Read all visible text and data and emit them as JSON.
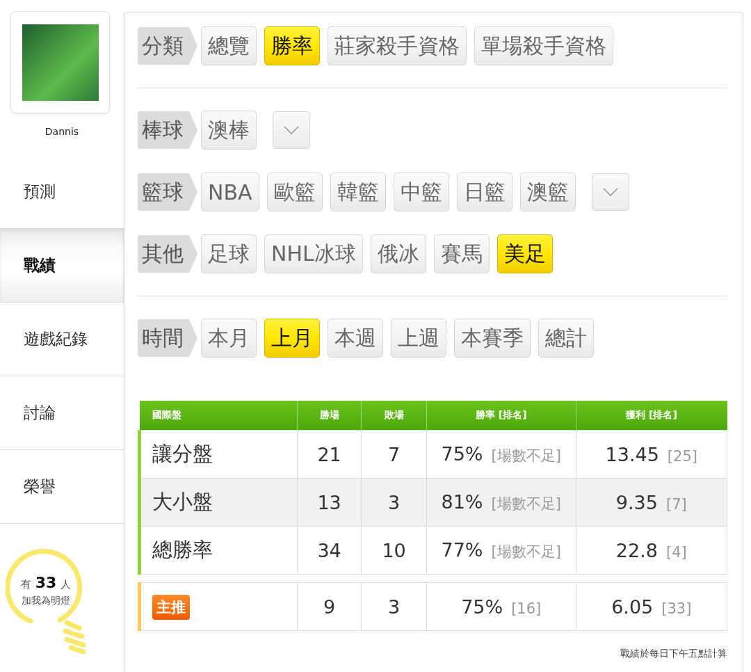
{
  "sidebar": {
    "username": "Dannis",
    "items": [
      {
        "label": "預測",
        "selected": false
      },
      {
        "label": "戰績",
        "selected": true
      },
      {
        "label": "遊戲紀錄",
        "selected": false
      },
      {
        "label": "討論",
        "selected": false
      },
      {
        "label": "榮譽",
        "selected": false
      }
    ],
    "fans": {
      "prefix": "有",
      "count": "33",
      "suffix": "人",
      "caption": "加我為明燈"
    }
  },
  "filter_sections": [
    [
      {
        "label": "分類",
        "dropdown": false,
        "options": [
          {
            "label": "總覽",
            "selected": false
          },
          {
            "label": "勝率",
            "selected": true
          },
          {
            "label": "莊家殺手資格",
            "selected": false
          },
          {
            "label": "單場殺手資格",
            "selected": false
          }
        ]
      }
    ],
    [
      {
        "label": "棒球",
        "dropdown": true,
        "options": [
          {
            "label": "澳棒",
            "selected": false
          }
        ]
      },
      {
        "label": "籃球",
        "dropdown": true,
        "options": [
          {
            "label": "NBA",
            "selected": false
          },
          {
            "label": "歐籃",
            "selected": false
          },
          {
            "label": "韓籃",
            "selected": false
          },
          {
            "label": "中籃",
            "selected": false
          },
          {
            "label": "日籃",
            "selected": false
          },
          {
            "label": "澳籃",
            "selected": false
          }
        ]
      },
      {
        "label": "其他",
        "dropdown": false,
        "options": [
          {
            "label": "足球",
            "selected": false
          },
          {
            "label": "NHL冰球",
            "selected": false
          },
          {
            "label": "俄冰",
            "selected": false
          },
          {
            "label": "賽馬",
            "selected": false
          },
          {
            "label": "美足",
            "selected": true
          }
        ]
      }
    ],
    [
      {
        "label": "時間",
        "dropdown": false,
        "options": [
          {
            "label": "本月",
            "selected": false
          },
          {
            "label": "上月",
            "selected": true
          },
          {
            "label": "本週",
            "selected": false
          },
          {
            "label": "上週",
            "selected": false
          },
          {
            "label": "本賽季",
            "selected": false
          },
          {
            "label": "總計",
            "selected": false
          }
        ]
      }
    ]
  ],
  "table": {
    "columns": [
      "國際盤",
      "勝場",
      "敗場",
      "勝率 [排名]",
      "獲利 [排名]"
    ],
    "rows": [
      {
        "kind": "market",
        "name": "讓分盤",
        "wins": "21",
        "losses": "7",
        "rate": "75%",
        "rate_rank": "[場數不足]",
        "profit": "13.45",
        "profit_rank": "[25]"
      },
      {
        "kind": "market",
        "name": "大小盤",
        "wins": "13",
        "losses": "3",
        "rate": "81%",
        "rate_rank": "[場數不足]",
        "profit": "9.35",
        "profit_rank": "[7]"
      },
      {
        "kind": "market",
        "name": "總勝率",
        "wins": "34",
        "losses": "10",
        "rate": "77%",
        "rate_rank": "[場數不足]",
        "profit": "22.8",
        "profit_rank": "[4]"
      },
      {
        "kind": "featured",
        "name": "主推",
        "wins": "9",
        "losses": "3",
        "rate": "75%",
        "rate_rank": "[16]",
        "profit": "6.05",
        "profit_rank": "[33]"
      }
    ]
  },
  "footnote": "戰績於每日下午五點計算"
}
